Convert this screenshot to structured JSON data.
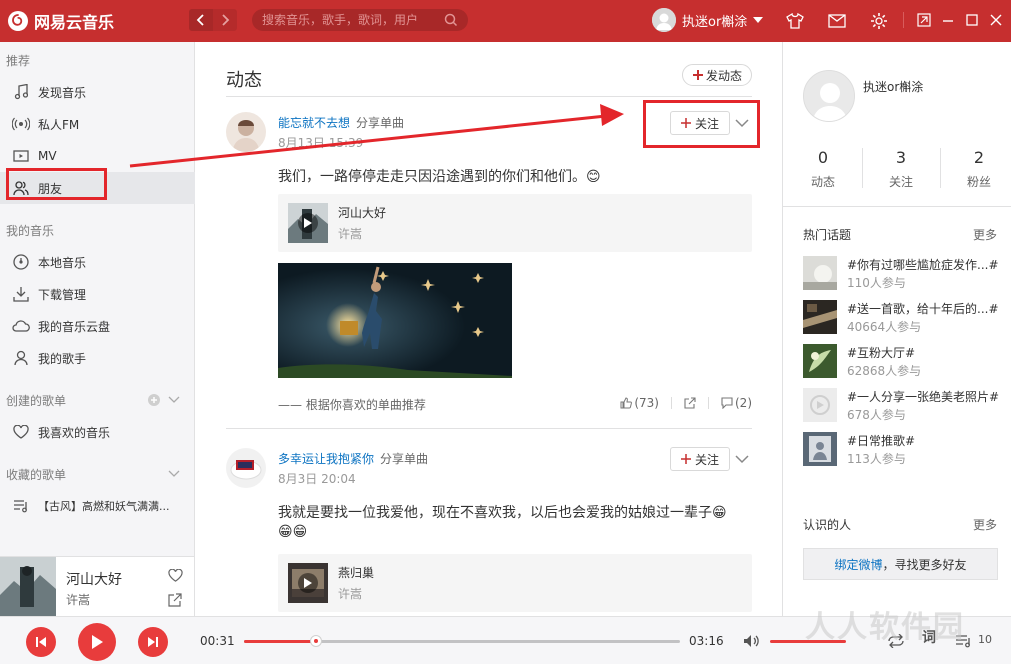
{
  "app": {
    "name": "网易云音乐"
  },
  "titlebar": {
    "search_placeholder": "搜索音乐，歌手，歌词，用户",
    "username": "执迷or槲涂"
  },
  "sidebar": {
    "recommend_header": "推荐",
    "recommend_items": [
      {
        "label": "发现音乐",
        "icon": "music-note-icon"
      },
      {
        "label": "私人FM",
        "icon": "radio-icon"
      },
      {
        "label": "MV",
        "icon": "mv-icon"
      },
      {
        "label": "朋友",
        "icon": "friends-icon",
        "active": true
      }
    ],
    "my_music_header": "我的音乐",
    "my_music_items": [
      {
        "label": "本地音乐",
        "icon": "local-music-icon"
      },
      {
        "label": "下载管理",
        "icon": "download-icon"
      },
      {
        "label": "我的音乐云盘",
        "icon": "cloud-icon"
      },
      {
        "label": "我的歌手",
        "icon": "singer-icon"
      }
    ],
    "created_header": "创建的歌单",
    "created_items": [
      {
        "label": "我喜欢的音乐",
        "icon": "heart-icon"
      }
    ],
    "collected_header": "收藏的歌单",
    "collected_items": [
      {
        "label": "【古风】高燃和妖气满满...",
        "icon": "playlist-icon"
      }
    ]
  },
  "now_playing": {
    "title": "河山大好",
    "artist": "许嵩"
  },
  "main": {
    "title": "动态",
    "post_button": "发动态",
    "feeds": [
      {
        "user": "能忘就不去想",
        "action": "分享单曲",
        "date": "8月13日 15:39",
        "follow_label": "关注",
        "text": "我们，一路停停走走只因沿途遇到的你们和他们。😊",
        "song_name": "河山大好",
        "song_artist": "许嵩",
        "recommend": "—— 根据你喜欢的单曲推荐",
        "likes": "(73)",
        "comments": "(2)"
      },
      {
        "user": "多幸运让我抱紧你",
        "action": "分享单曲",
        "date": "8月3日 20:04",
        "follow_label": "关注",
        "text": "我就是要找一位我爱他，现在不喜欢我，以后也会爱我的姑娘过一辈子😁",
        "text2": "😁😁",
        "song_name": "燕归巢",
        "song_artist": "许嵩"
      }
    ]
  },
  "right": {
    "username": "执迷or槲涂",
    "stats": [
      {
        "num": "0",
        "label": "动态"
      },
      {
        "num": "3",
        "label": "关注"
      },
      {
        "num": "2",
        "label": "粉丝"
      }
    ],
    "hot_topics_title": "热门话题",
    "more": "更多",
    "topics": [
      {
        "title": "#你有过哪些尴尬症发作...#",
        "count": "110人参与"
      },
      {
        "title": "#送一首歌，给十年后的...#",
        "count": "40664人参与"
      },
      {
        "title": "#互粉大厅#",
        "count": "62868人参与"
      },
      {
        "title": "#一人分享一张绝美老照片#",
        "count": "678人参与"
      },
      {
        "title": "#日常推歌#",
        "count": "113人参与"
      }
    ],
    "known_people_title": "认识的人",
    "bind_link": "绑定微博",
    "bind_text": "，寻找更多好友"
  },
  "player": {
    "current_time": "00:31",
    "total_time": "03:16",
    "progress": 0.165,
    "volume": 1.0,
    "lyric_label": "词",
    "playlist_count": "10"
  },
  "watermark": "人人软件园",
  "colors": {
    "brand": "#c62f2f",
    "accent": "#e83c3c",
    "link": "#0c73c2",
    "highlight": "#e3262b"
  }
}
